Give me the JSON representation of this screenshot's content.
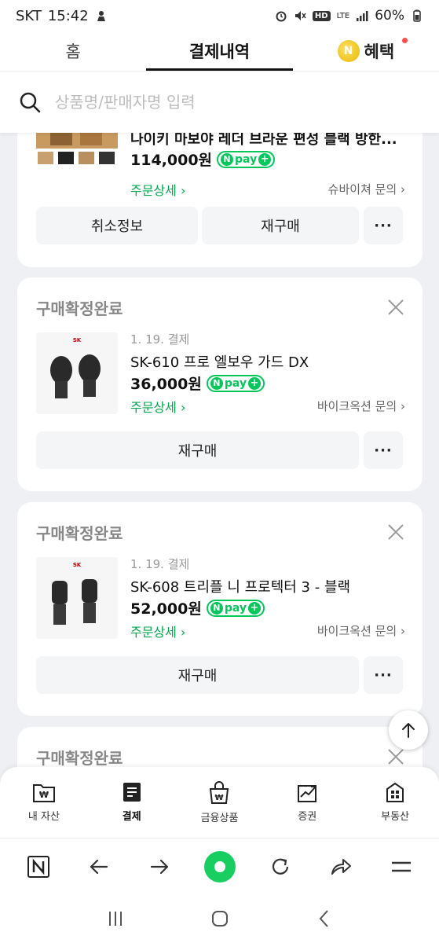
{
  "status": {
    "carrier": "SKT",
    "time": "15:42",
    "hd": "HD",
    "network": "LTE",
    "battery": "60%"
  },
  "tabs": [
    {
      "label": "홈"
    },
    {
      "label": "결제내역"
    },
    {
      "label": "혜택"
    }
  ],
  "search": {
    "placeholder": "상품명/판매자명 입력"
  },
  "cards": [
    {
      "status": "",
      "date": "",
      "product": "나이키 마보야 레더 브라운 편성 블랙 방한...",
      "price": "114,000원",
      "detail": "주문상세",
      "seller": "슈바이쳐 문의",
      "buttons": [
        "취소정보",
        "재구매"
      ]
    },
    {
      "status": "구매확정완료",
      "date": "1. 19. 결제",
      "product": "SK-610 프로 엘보우 가드 DX",
      "price": "36,000원",
      "detail": "주문상세",
      "seller": "바이크옥션 문의",
      "buttons": [
        "재구매"
      ]
    },
    {
      "status": "구매확정완료",
      "date": "1. 19. 결제",
      "product": "SK-608 트리플 니 프로텍터 3 - 블랙",
      "price": "52,000원",
      "detail": "주문상세",
      "seller": "바이크옥션 문의",
      "buttons": [
        "재구매"
      ]
    },
    {
      "status": "구매확정완료"
    }
  ],
  "npay": {
    "label": "pay"
  },
  "bottom_nav": [
    {
      "label": "내 자산"
    },
    {
      "label": "결제"
    },
    {
      "label": "금융상품"
    },
    {
      "label": "증권"
    },
    {
      "label": "부동산"
    }
  ],
  "colors": {
    "accent_green": "#03c75a",
    "text_gray": "#888888"
  }
}
